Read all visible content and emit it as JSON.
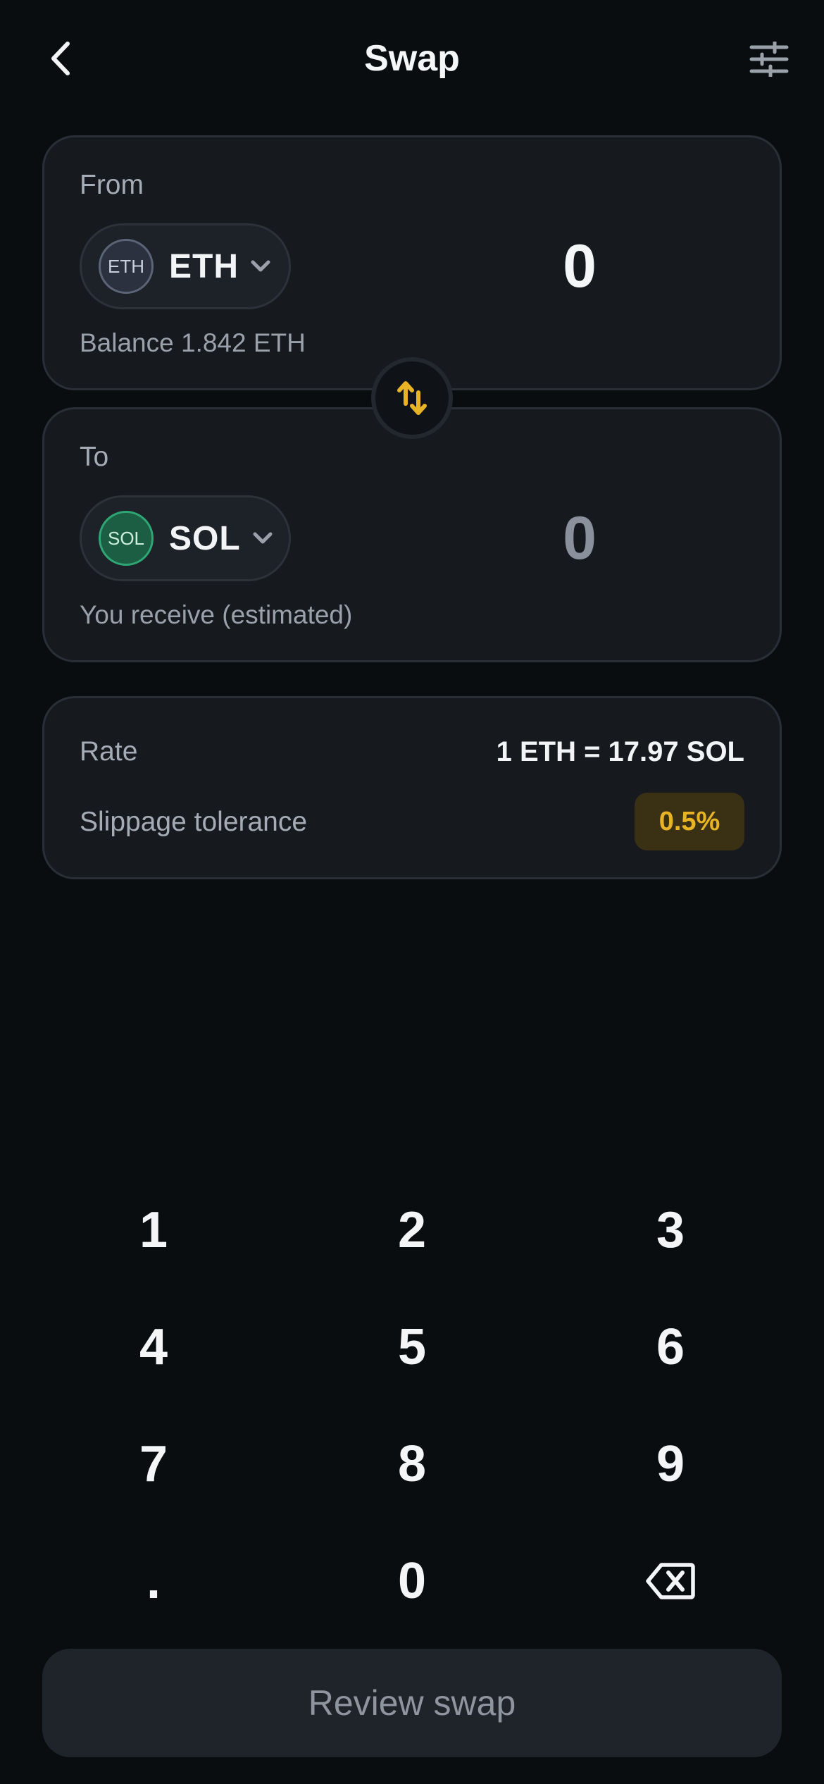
{
  "header": {
    "title": "Swap",
    "back_icon": "chevron-left-icon",
    "settings_icon": "sliders-icon"
  },
  "from": {
    "label": "From",
    "token_badge": "ETH",
    "token_symbol": "ETH",
    "amount": "0",
    "balance_text": "Balance 1.842 ETH"
  },
  "to": {
    "label": "To",
    "token_badge": "SOL",
    "token_symbol": "SOL",
    "amount": "0",
    "note": "You receive (estimated)"
  },
  "swap_direction_icon": "swap-arrows-icon",
  "info": {
    "rate_label": "Rate",
    "rate_value": "1 ETH = 17.97 SOL",
    "slippage_label": "Slippage tolerance",
    "slippage_value": "0.5%"
  },
  "keypad": {
    "keys": [
      "1",
      "2",
      "3",
      "4",
      "5",
      "6",
      "7",
      "8",
      "9",
      ".",
      "0"
    ],
    "backspace_icon": "backspace-icon"
  },
  "review_button": "Review swap",
  "colors": {
    "background": "#0a0d10",
    "card": "#16191e",
    "accent": "#e8b425",
    "eth_badge": "#2c3140",
    "sol_badge": "#1c5e44"
  }
}
